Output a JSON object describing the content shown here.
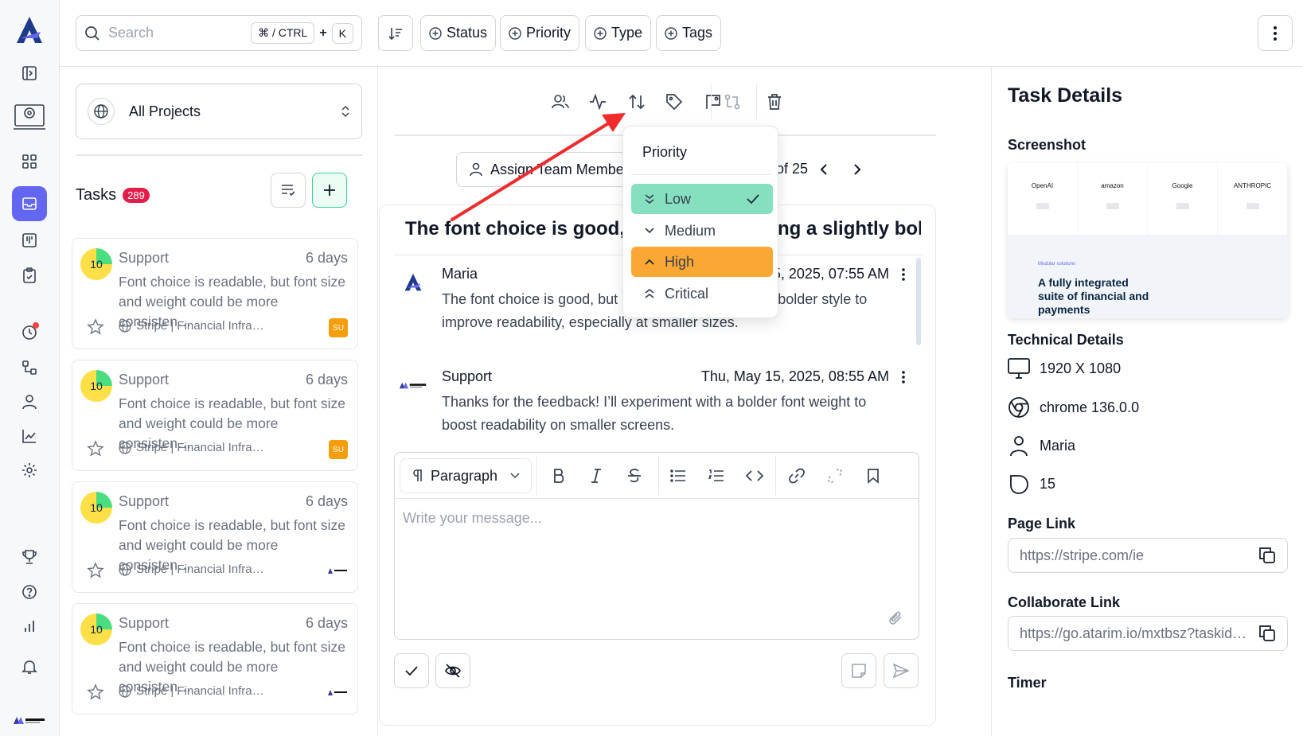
{
  "search": {
    "placeholder": "Search",
    "shortcut_mod": "⌘ / CTRL",
    "shortcut_plus": "+",
    "shortcut_key": "K"
  },
  "filters": {
    "status": "Status",
    "priority": "Priority",
    "type": "Type",
    "tags": "Tags"
  },
  "project_selector": {
    "label": "All Projects"
  },
  "tasks": {
    "title": "Tasks",
    "count": "289"
  },
  "task_cards": [
    {
      "score": "10",
      "author": "Support",
      "age": "6 days",
      "text": "Font choice is readable, but font size and weight could be more consisten…",
      "site": "Stripe | Financial Infra…",
      "badge": "SU"
    },
    {
      "score": "10",
      "author": "Support",
      "age": "6 days",
      "text": "Font choice is readable, but font size and weight could be more consisten…",
      "site": "Stripe | Financial Infra…",
      "badge": "SU"
    },
    {
      "score": "10",
      "author": "Support",
      "age": "6 days",
      "text": "Font choice is readable, but font size and weight could be more consisten…",
      "site": "Stripe | Financial Infra…",
      "badge": ""
    },
    {
      "score": "10",
      "author": "Support",
      "age": "6 days",
      "text": "Font choice is readable, but font size and weight could be more consisten…",
      "site": "Stripe | Financial Infra…",
      "badge": ""
    }
  ],
  "assign": {
    "label": "Assign Team Member"
  },
  "pager": {
    "text": "0 of 25"
  },
  "task": {
    "title": "The font choice is good, but consider using a slightly bolder…"
  },
  "messages": [
    {
      "author": "Maria",
      "time": "Thu, May 15, 2025, 07:55 AM",
      "body": "The font choice is good, but consider using a slightly bolder style to improve readability, especially at smaller sizes."
    },
    {
      "author": "Support",
      "time": "Thu, May 15, 2025, 08:55 AM",
      "body": "Thanks for the feedback! I’ll experiment with a bolder font weight to boost readability on smaller screens."
    }
  ],
  "editor": {
    "block_type": "Paragraph",
    "placeholder": "Write your message..."
  },
  "priority_dropdown": {
    "header": "Priority",
    "options": [
      {
        "label": "Low",
        "state": "selected"
      },
      {
        "label": "Medium",
        "state": "normal"
      },
      {
        "label": "High",
        "state": "highlighted"
      },
      {
        "label": "Critical",
        "state": "normal"
      }
    ],
    "colors": {
      "selected": "#86e0c0",
      "highlighted": "#fba733"
    }
  },
  "details": {
    "title": "Task Details",
    "screenshot_label": "Screenshot",
    "screenshot": {
      "logos": [
        "OpenAI",
        "amazon",
        "Google",
        "ANTHROPIC"
      ],
      "kicker": "Modular solutions",
      "headline": "A fully integrated suite of financial and payments"
    },
    "technical_label": "Technical Details",
    "resolution": "1920 X 1080",
    "browser": "chrome 136.0.0",
    "user": "Maria",
    "os": "15",
    "page_link_label": "Page Link",
    "page_link": "https://stripe.com/ie",
    "collab_link_label": "Collaborate Link",
    "collab_link": "https://go.atarim.io/mxtbsz?taskid…",
    "timer_label": "Timer"
  },
  "colors": {
    "accent": "#6366f1",
    "badge": "#e11d48",
    "annotation_arrow": "#ef2b2b"
  }
}
